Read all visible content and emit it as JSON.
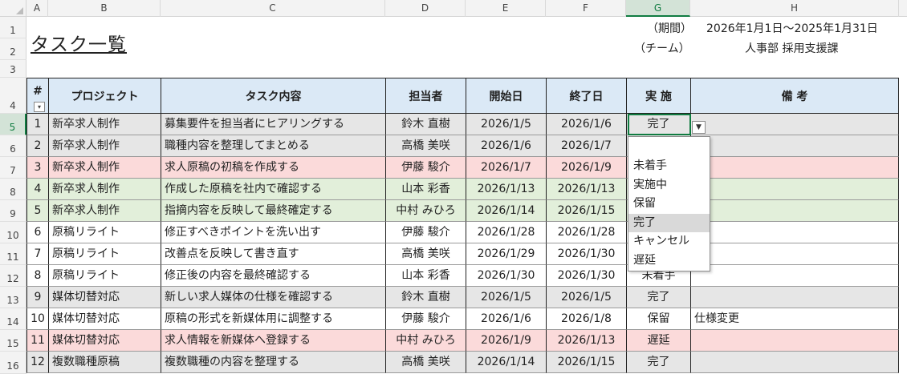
{
  "columns": [
    "A",
    "B",
    "C",
    "D",
    "E",
    "F",
    "G",
    "H"
  ],
  "active_column": "G",
  "row_numbers": [
    "1",
    "2",
    "3",
    "4",
    "5",
    "6",
    "7",
    "8",
    "9",
    "10",
    "11",
    "12",
    "13",
    "14",
    "15",
    "16"
  ],
  "active_row": "5",
  "title": "タスク一覧",
  "meta": {
    "period_label": "（期間）",
    "period_value": "2026年1月1日～2025年1月31日",
    "team_label": "（チーム）",
    "team_value": "人事部 採用支援課"
  },
  "headers": [
    "#",
    "プロジェクト",
    "タスク内容",
    "担当者",
    "開始日",
    "終了日",
    "実 施",
    "備 考"
  ],
  "rows": [
    {
      "no": "1",
      "project": "新卒求人制作",
      "task": "募集要件を担当者にヒアリングする",
      "owner": "鈴木 直樹",
      "start": "2026/1/5",
      "end": "2026/1/6",
      "status": "完了",
      "note": "",
      "bg": "#e6e6e6"
    },
    {
      "no": "2",
      "project": "新卒求人制作",
      "task": "職種内容を整理してまとめる",
      "owner": "高橋 美咲",
      "start": "2026/1/6",
      "end": "2026/1/7",
      "status": "",
      "note": "",
      "bg": "#e6e6e6"
    },
    {
      "no": "3",
      "project": "新卒求人制作",
      "task": "求人原稿の初稿を作成する",
      "owner": "伊藤 駿介",
      "start": "2026/1/7",
      "end": "2026/1/9",
      "status": "",
      "note": "",
      "bg": "#fbdada"
    },
    {
      "no": "4",
      "project": "新卒求人制作",
      "task": "作成した原稿を社内で確認する",
      "owner": "山本 彩香",
      "start": "2026/1/13",
      "end": "2026/1/13",
      "status": "",
      "note": "",
      "bg": "#e2efda"
    },
    {
      "no": "5",
      "project": "新卒求人制作",
      "task": "指摘内容を反映して最終確定する",
      "owner": "中村 みひろ",
      "start": "2026/1/14",
      "end": "2026/1/15",
      "status": "",
      "note": "",
      "bg": "#e2efda"
    },
    {
      "no": "6",
      "project": "原稿リライト",
      "task": "修正すべきポイントを洗い出す",
      "owner": "伊藤 駿介",
      "start": "2026/1/28",
      "end": "2026/1/28",
      "status": "",
      "note": "",
      "bg": "#ffffff"
    },
    {
      "no": "7",
      "project": "原稿リライト",
      "task": "改善点を反映して書き直す",
      "owner": "高橋 美咲",
      "start": "2026/1/29",
      "end": "2026/1/30",
      "status": "",
      "note": "",
      "bg": "#ffffff"
    },
    {
      "no": "8",
      "project": "原稿リライト",
      "task": "修正後の内容を最終確認する",
      "owner": "山本 彩香",
      "start": "2026/1/30",
      "end": "2026/1/30",
      "status": "未着手",
      "note": "",
      "bg": "#ffffff"
    },
    {
      "no": "9",
      "project": "媒体切替対応",
      "task": "新しい求人媒体の仕様を確認する",
      "owner": "鈴木 直樹",
      "start": "2026/1/5",
      "end": "2026/1/5",
      "status": "完了",
      "note": "",
      "bg": "#e6e6e6"
    },
    {
      "no": "10",
      "project": "媒体切替対応",
      "task": "原稿の形式を新媒体用に調整する",
      "owner": "伊藤 駿介",
      "start": "2026/1/6",
      "end": "2026/1/8",
      "status": "保留",
      "note": "仕様変更",
      "bg": "#ffffff"
    },
    {
      "no": "11",
      "project": "媒体切替対応",
      "task": "求人情報を新媒体へ登録する",
      "owner": "中村 みひろ",
      "start": "2026/1/9",
      "end": "2026/1/13",
      "status": "遅延",
      "note": "",
      "bg": "#fbdada"
    },
    {
      "no": "12",
      "project": "複数職種原稿",
      "task": "複数職種の内容を整理する",
      "owner": "高橋 美咲",
      "start": "2026/1/14",
      "end": "2026/1/15",
      "status": "完了",
      "note": "",
      "bg": "#e6e6e6"
    }
  ],
  "dropdown": {
    "options": [
      "未着手",
      "実施中",
      "保留",
      "完了",
      "キャンセル",
      "遅延"
    ],
    "highlighted": "完了"
  },
  "icons": {
    "filter": "filter-dropdown-icon",
    "list_arrow": "chevron-down-icon"
  }
}
